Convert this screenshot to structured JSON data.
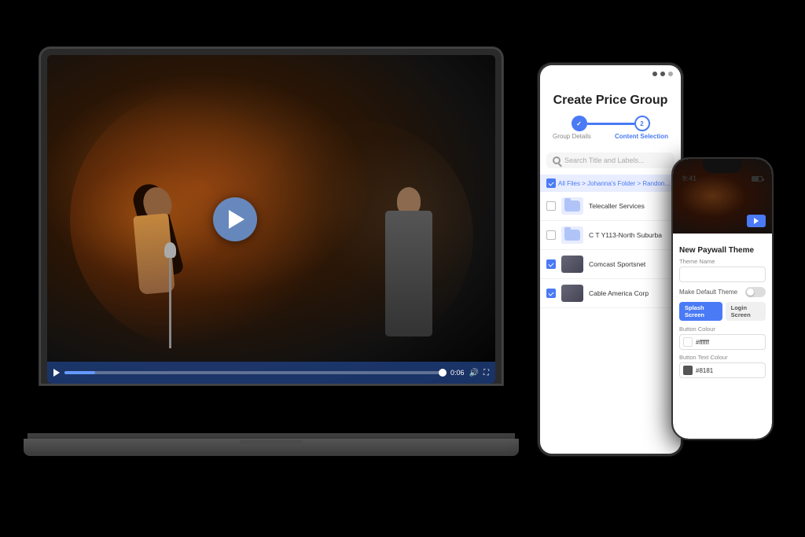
{
  "scene": {
    "bg": "#000"
  },
  "laptop": {
    "video": {
      "play_button_label": "Play",
      "time": "0:06",
      "progress_percent": 8
    }
  },
  "tablet": {
    "title": "Create Price Group",
    "status_bar": {
      "dots": 3
    },
    "stepper": {
      "step1_label": "Group Details",
      "step2_label": "Content Selection",
      "step1_complete": true,
      "step2_active": true
    },
    "search": {
      "placeholder": "Search Title and Labels..."
    },
    "breadcrumb": {
      "text": "All Files > Johanna's Folder > Randon..."
    },
    "file_items": [
      {
        "name": "Telecaller Services",
        "type": "folder",
        "checked": false
      },
      {
        "name": "C T Y113-North Suburban",
        "type": "folder",
        "checked": false
      },
      {
        "name": "Comcast Sportsnet",
        "type": "video",
        "checked": true
      },
      {
        "name": "Cable America Corp",
        "type": "video",
        "checked": true
      }
    ]
  },
  "phone": {
    "status": {
      "time": "9:41",
      "battery": "70"
    },
    "hero": {
      "has_video": true
    },
    "form": {
      "title": "New Paywall Theme",
      "theme_name_label": "Theme Name",
      "theme_name_value": "",
      "make_default_label": "Make Default Theme",
      "button_color_label": "Button Colour",
      "button_color_value": "#ffffff",
      "button_text_color_label": "Button Text Colour",
      "button_text_color_value": "#8181"
    },
    "tabs": [
      {
        "label": "Splash Screen",
        "active": true
      },
      {
        "label": "Login Screen",
        "active": false
      }
    ]
  }
}
